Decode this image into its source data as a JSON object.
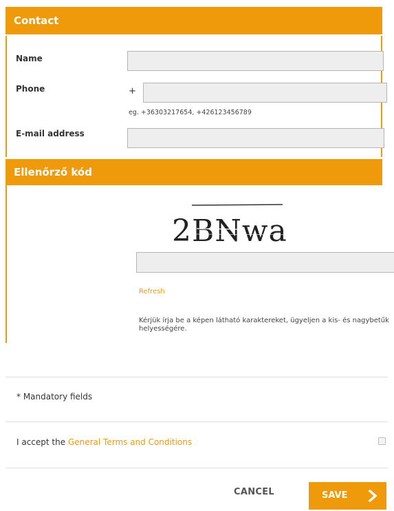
{
  "contact": {
    "header": "Contact",
    "name_label": "Name",
    "name_value": "",
    "phone_label": "Phone",
    "phone_prefix": "+",
    "phone_value": "",
    "phone_hint": "eg. +36303217654, +426123456789",
    "email_label": "E-mail address",
    "email_value": ""
  },
  "captcha": {
    "header": "Ellenőrző kód",
    "image_text": "2BNwa",
    "input_value": "",
    "refresh_label": "Refresh",
    "instructions": "Kérjük írja be a képen látható karaktereket, ügyeljen a kis- és nagybetűk helyességére."
  },
  "footer": {
    "mandatory_text": "* Mandatory fields",
    "terms_prefix": "I accept the ",
    "terms_link": "General Terms and Conditions",
    "terms_checked": false
  },
  "actions": {
    "cancel_label": "CANCEL",
    "save_label": "SAVE"
  },
  "colors": {
    "accent": "#ef9a0b",
    "input_bg": "#eeeeee",
    "input_border": "#b5b5b5"
  },
  "icons": {
    "save_icon": "chevron-right-icon"
  }
}
